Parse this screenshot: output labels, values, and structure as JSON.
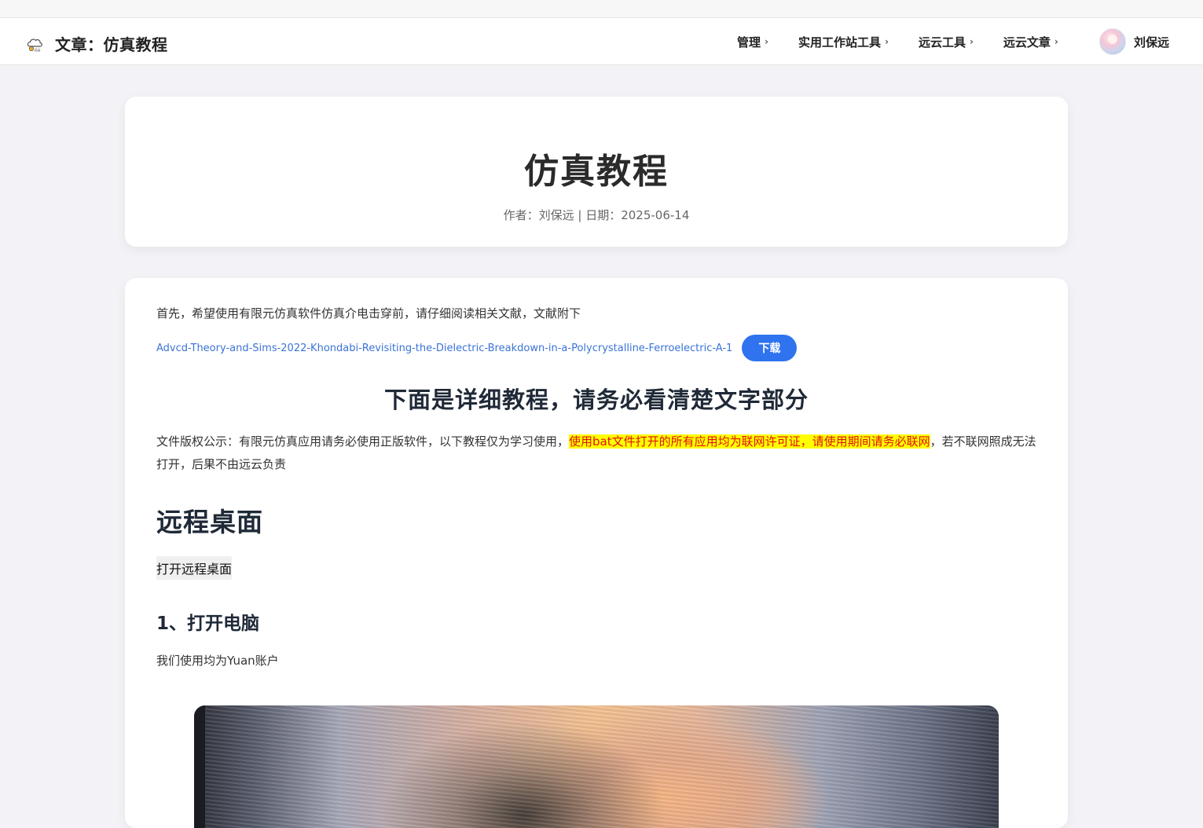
{
  "navbar": {
    "brand_title": "文章：仿真教程",
    "items": [
      {
        "label": "管理",
        "chevron": "›"
      },
      {
        "label": "实用工作站工具",
        "chevron": "›"
      },
      {
        "label": "远云工具",
        "chevron": "›"
      },
      {
        "label": "远云文章",
        "chevron": "›"
      }
    ],
    "user_name": "刘保远"
  },
  "header": {
    "title": "仿真教程",
    "meta": "作者：刘保远 | 日期：2025-06-14"
  },
  "content": {
    "intro": "首先，希望使用有限元仿真软件仿真介电击穿前，请仔细阅读相关文献，文献附下",
    "file_link": "Advcd-Theory-and-Sims-2022-Khondabi-Revisiting-the-Dielectric-Breakdown-in-a-Polycrystalline-Ferroelectric-A-1",
    "download_label": "下载",
    "section_title": "下面是详细教程，请务必看清楚文字部分",
    "copyright_prefix": "文件版权公示：有限元仿真应用请务必使用正版软件，以下教程仅为学习使用，",
    "copyright_highlight": "使用bat文件打开的所有应用均为联网许可证，请使用期间请务必联网",
    "copyright_suffix": "，若不联网照成无法打开，后果不由远云负责",
    "remote_heading": "远程桌面",
    "open_rdp_label": "打开远程桌面",
    "step1_heading": "1、打开电脑",
    "account_text": "我们使用均为Yuan账户"
  },
  "colors": {
    "accent": "#2f73ef",
    "link": "#3b74d6",
    "highlight_bg": "#ffff00",
    "highlight_text": "#e01010"
  },
  "icons": {
    "brand_logo": "cloud-logo-icon",
    "avatar": "user-avatar"
  }
}
